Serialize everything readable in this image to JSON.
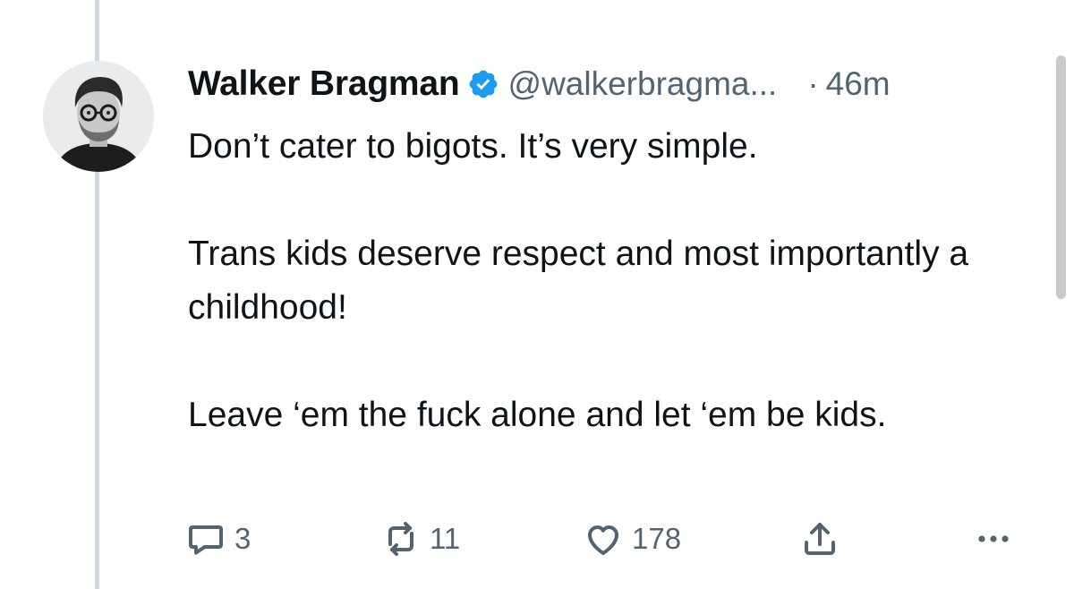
{
  "tweet": {
    "author": {
      "display_name": "Walker Bragman",
      "handle": "@walkerbragma...",
      "verified": true
    },
    "separator": "·",
    "timestamp": "46m",
    "paragraphs": [
      "Don’t cater to bigots. It’s very simple.",
      "Trans kids deserve respect and most importantly a childhood!",
      "Leave ‘em the fuck alone and let ‘em be kids."
    ],
    "actions": {
      "replies": "3",
      "retweets": "11",
      "likes": "178"
    }
  },
  "icons": {
    "reply": "comment-bubble-icon",
    "retweet": "retweet-arrows-icon",
    "like": "heart-icon",
    "share": "share-upload-icon",
    "more": "more-dots-icon",
    "verified": "verified-badge-icon"
  },
  "colors": {
    "verified_blue": "#1d9bf0",
    "secondary_text": "#536471",
    "thread_line": "#cfd9de"
  }
}
